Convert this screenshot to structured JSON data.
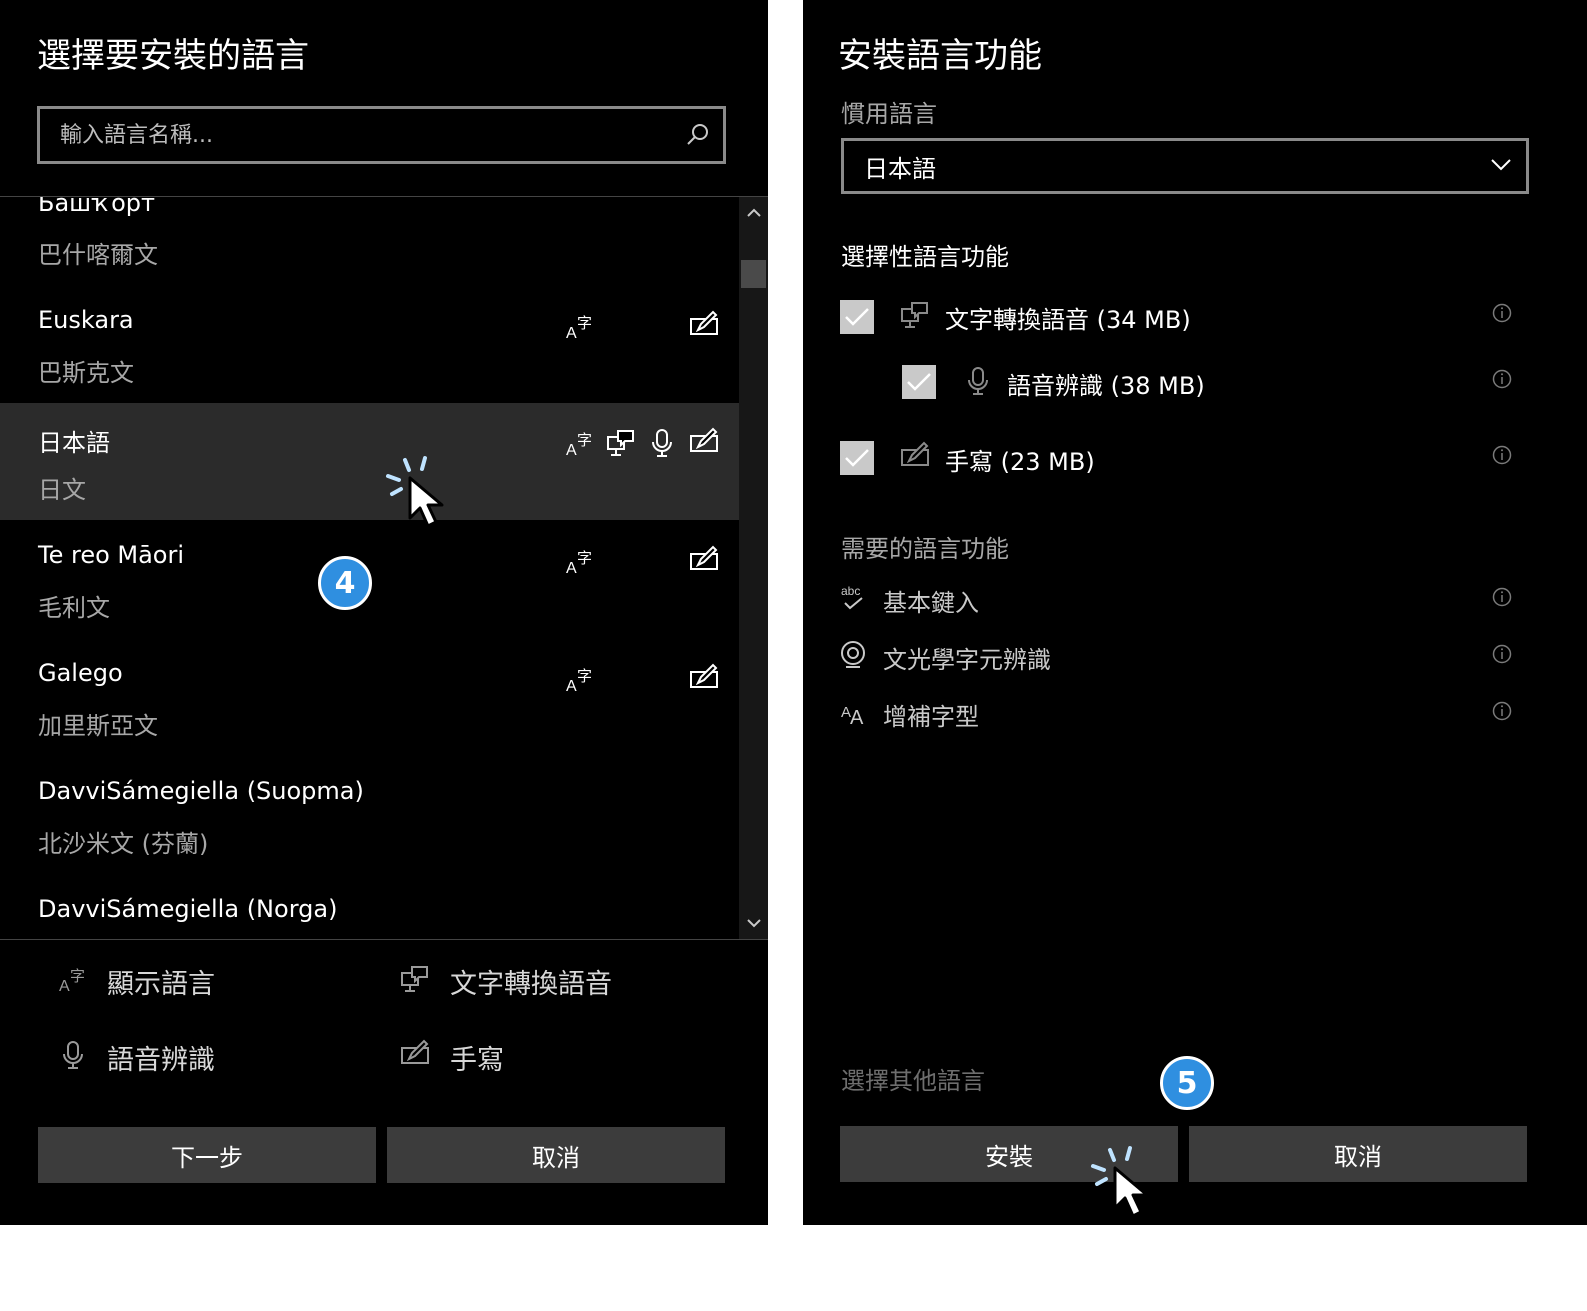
{
  "left_panel": {
    "title": "選擇要安裝的語言",
    "search_placeholder": "輸入語言名稱...",
    "languages": [
      {
        "native": "Башҡорт",
        "chinese": "巴什喀爾文",
        "features": []
      },
      {
        "native": "Euskara",
        "chinese": "巴斯克文",
        "features": [
          "display-language-icon",
          "handwriting-icon"
        ]
      },
      {
        "native": "日本語",
        "chinese": "日文",
        "features": [
          "display-language-icon",
          "text-to-speech-icon",
          "microphone-icon",
          "handwriting-icon"
        ],
        "selected": true
      },
      {
        "native": "Te reo Māori",
        "chinese": "毛利文",
        "features": [
          "display-language-icon",
          "handwriting-icon"
        ]
      },
      {
        "native": "Galego",
        "chinese": "加里斯亞文",
        "features": [
          "display-language-icon",
          "handwriting-icon"
        ]
      },
      {
        "native": "DavviSámegiella (Suopma)",
        "chinese": "北沙米文 (芬蘭)",
        "features": []
      },
      {
        "native": "DavviSámegiella (Norga)",
        "chinese": "",
        "features": []
      }
    ],
    "legend": {
      "display_language": "顯示語言",
      "text_to_speech": "文字轉換語音",
      "speech_recognition": "語音辨識",
      "handwriting": "手寫"
    },
    "next_button": "下一步",
    "cancel_button": "取消",
    "step_badge": "4"
  },
  "right_panel": {
    "title": "安裝語言功能",
    "preferred_label": "慣用語言",
    "preferred_value": "日本語",
    "optional_heading": "選擇性語言功能",
    "optional_features": [
      {
        "label": "文字轉換語音 (34 MB)",
        "icon": "text-to-speech-icon",
        "checked": true
      },
      {
        "label": "語音辨識 (38 MB)",
        "icon": "microphone-icon",
        "checked": true
      },
      {
        "label": "手寫 (23 MB)",
        "icon": "handwriting-icon",
        "checked": true
      }
    ],
    "required_heading": "需要的語言功能",
    "required_features": [
      {
        "label": "基本鍵入",
        "icon": "spellcheck-icon"
      },
      {
        "label": "文光學字元辨識",
        "icon": "ocr-icon"
      },
      {
        "label": "增補字型",
        "icon": "font-icon"
      }
    ],
    "icon_text": {
      "abc": "abc",
      "font_a": "A",
      "info": "i"
    },
    "choose_other": "選擇其他語言",
    "install_button": "安裝",
    "cancel_button": "取消",
    "step_badge": "5"
  },
  "colors": {
    "badge": "#2f8fe0",
    "panel": "#000000",
    "button": "#3c3c3c",
    "selected_row": "#2b2b2b"
  }
}
